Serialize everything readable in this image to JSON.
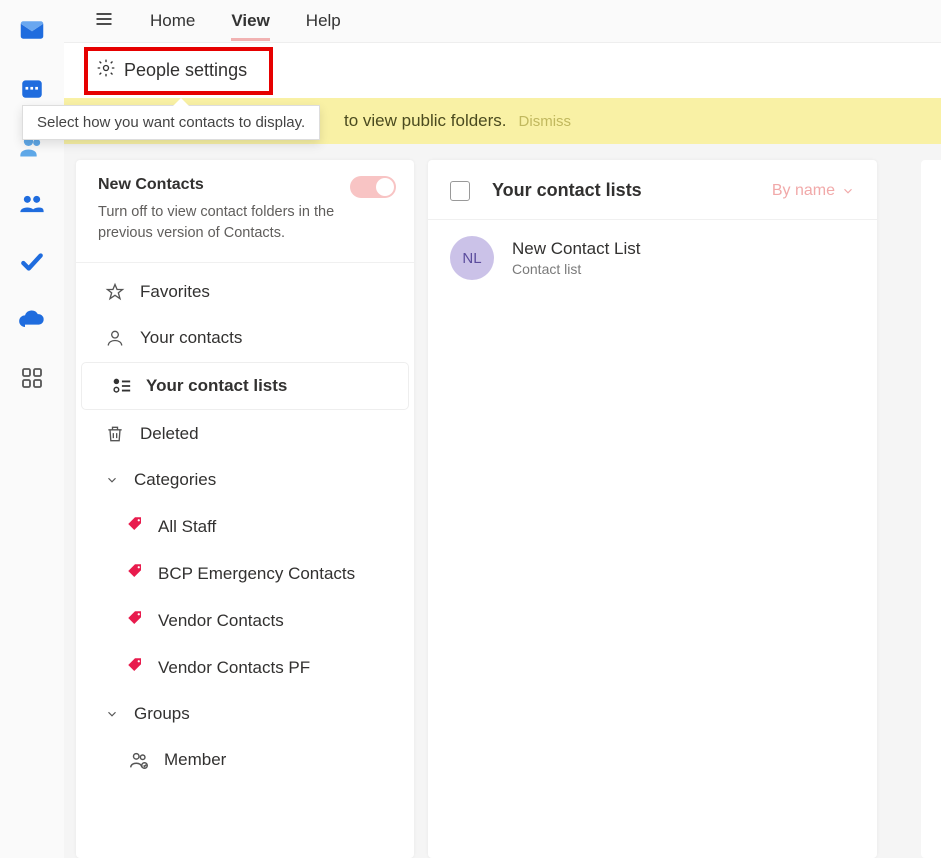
{
  "topTabs": {
    "home": "Home",
    "view": "View",
    "help": "Help"
  },
  "ribbon": {
    "peopleSettings": "People settings"
  },
  "tooltip": "Select how you want contacts to display.",
  "banner": {
    "text": "to view public folders.",
    "dismiss": "Dismiss"
  },
  "newContacts": {
    "title": "New Contacts",
    "desc": "Turn off to view contact folders in the previous version of Contacts."
  },
  "nav": {
    "favorites": "Favorites",
    "yourContacts": "Your contacts",
    "yourContactLists": "Your contact lists",
    "deleted": "Deleted",
    "categories": "Categories",
    "groups": "Groups",
    "member": "Member"
  },
  "categories": {
    "c0": "All Staff",
    "c1": "BCP Emergency Contacts",
    "c2": "Vendor Contacts",
    "c3": "Vendor Contacts PF"
  },
  "list": {
    "header": "Your contact lists",
    "sort": "By name",
    "item0": {
      "initials": "NL",
      "title": "New Contact List",
      "sub": "Contact list"
    }
  }
}
